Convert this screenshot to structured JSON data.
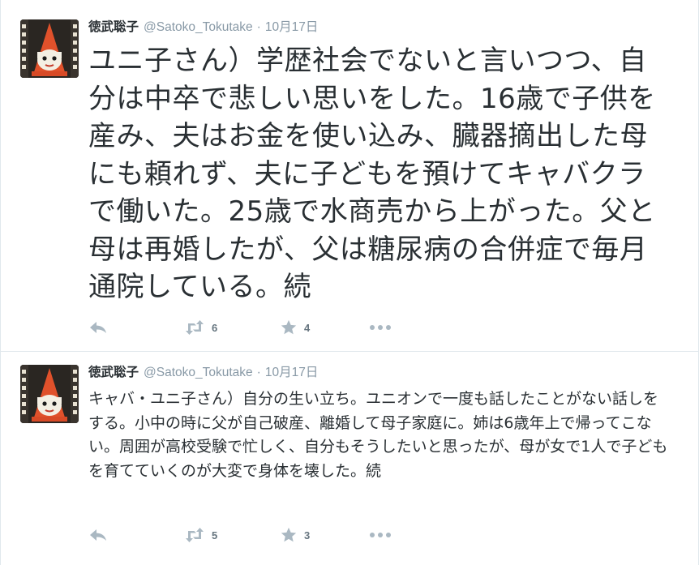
{
  "tweets": [
    {
      "fullname": "徳武聡子",
      "username": "@Satoko_Tokutake",
      "separator": "·",
      "time": "10月17日",
      "text": "ユニ子さん）学歴社会でないと言いつつ、自分は中卒で悲しい思いをした。16歳で子供を産み、夫はお金を使い込み、臓器摘出した母にも頼れず、夫に子どもを預けてキャバクラで働いた。25歳で水商売から上がった。父と母は再婚したが、父は糖尿病の合併症で毎月通院している。続",
      "retweets": "6",
      "favorites": "4"
    },
    {
      "fullname": "徳武聡子",
      "username": "@Satoko_Tokutake",
      "separator": "·",
      "time": "10月17日",
      "text": "キャバ・ユニ子さん）自分の生い立ち。ユニオンで一度も話したことがない話しをする。小中の時に父が自己破産、離婚して母子家庭に。姉は6歳年上で帰ってこない。周囲が高校受験で忙しく、自分もそうしたいと思ったが、母が女で1人で子どもを育てていくのが大変で身体を壊した。続",
      "retweets": "5",
      "favorites": "3"
    }
  ],
  "icons": {
    "reply": "reply-icon",
    "retweet": "retweet-icon",
    "favorite": "star-icon",
    "more": "more-icon",
    "avatar": "avatar-image"
  },
  "colors": {
    "text": "#292f33",
    "secondary": "#8899a6",
    "action_icon": "#aab8c2",
    "count": "#66757f",
    "divider": "#e1e8ed"
  }
}
